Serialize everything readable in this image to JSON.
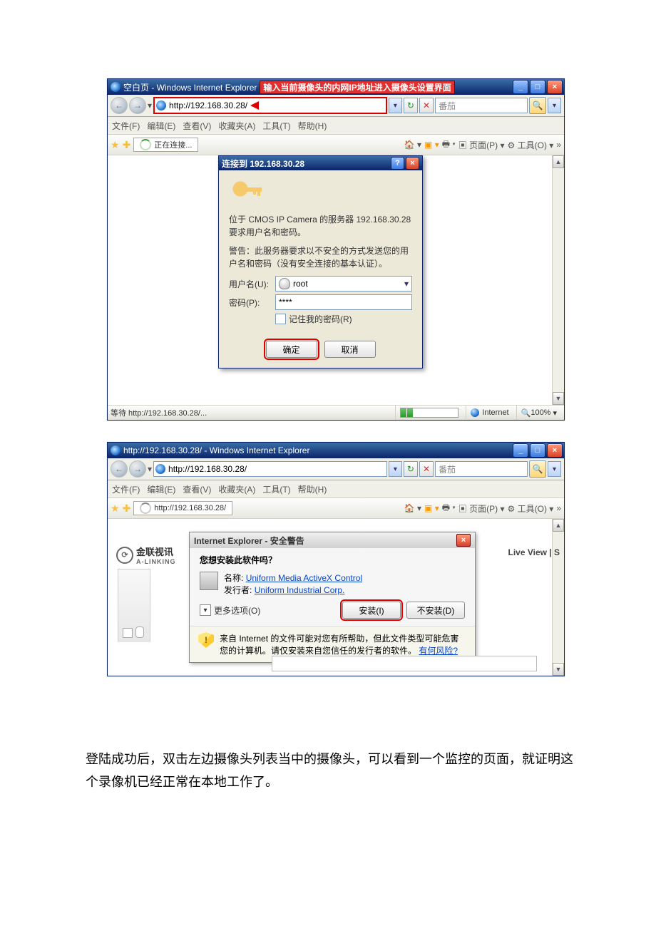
{
  "doc_text": {
    "paragraph": "登陆成功后，双击左边摄像头列表当中的摄像头，可以看到一个监控的页面，就证明这个录像机已经正常在本地工作了。"
  },
  "window1": {
    "title": "空白页 - Windows Internet Explorer",
    "title_annotation": "输入当前摄像头的内网IP地址进入摄像头设置界面",
    "url": "http://192.168.30.28/",
    "search_placeholder": "番茄",
    "menu": {
      "file": "文件(F)",
      "edit": "编辑(E)",
      "view": "查看(V)",
      "fav": "收藏夹(A)",
      "tools": "工具(T)",
      "help": "帮助(H)"
    },
    "tab_label": "正在连接...",
    "right_tools": {
      "page": "页面(P)",
      "tools": "工具(O)"
    },
    "auth": {
      "title": "连接到 192.168.30.28",
      "msg1": "位于 CMOS IP Camera 的服务器 192.168.30.28 要求用户名和密码。",
      "msg2": "警告：此服务器要求以不安全的方式发送您的用户名和密码（没有安全连接的基本认证）。",
      "user_label": "用户名(U):",
      "user_value": "root",
      "pass_label": "密码(P):",
      "pass_value": "****",
      "remember": "记住我的密码(R)",
      "ok": "确定",
      "cancel": "取消"
    },
    "status": {
      "left": "等待 http://192.168.30.28/...",
      "zone": "Internet",
      "zoom": "100%"
    }
  },
  "window2": {
    "title": "http://192.168.30.28/ - Windows Internet Explorer",
    "url": "http://192.168.30.28/",
    "search_placeholder": "番茄",
    "menu": {
      "file": "文件(F)",
      "edit": "编辑(E)",
      "view": "查看(V)",
      "fav": "收藏夹(A)",
      "tools": "工具(T)",
      "help": "帮助(H)"
    },
    "tab_label": "http://192.168.30.28/",
    "right_tools": {
      "page": "页面(P)",
      "tools": "工具(O)"
    },
    "brand": {
      "name": "金联视讯",
      "sub": "A-LINKING"
    },
    "liveview": "Live View  |  S",
    "sec": {
      "title": "Internet Explorer - 安全警告",
      "question": "您想安装此软件吗？",
      "name_label": "名称:",
      "name_value": "Uniform Media ActiveX Control",
      "pub_label": "发行者:",
      "pub_value": "Uniform Industrial Corp.",
      "more": "更多选项(O)",
      "install": "安装(I)",
      "noinstall": "不安装(D)",
      "warn": "来自 Internet 的文件可能对您有所帮助，但此文件类型可能危害您的计算机。请仅安装来自您信任的发行者的软件。",
      "risk": "有何风险?"
    }
  }
}
